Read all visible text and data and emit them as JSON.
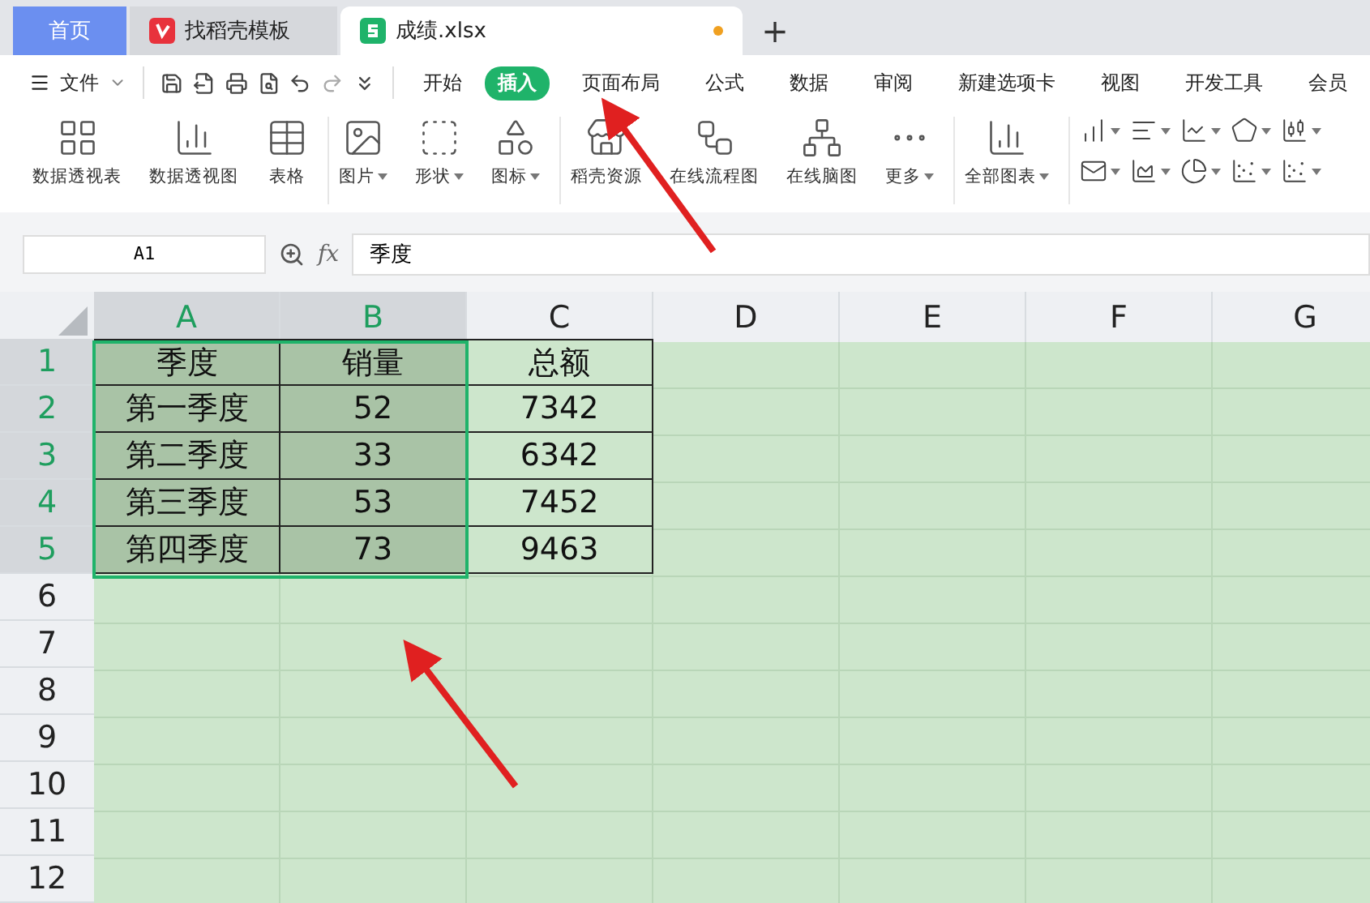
{
  "tabs": [
    {
      "kind": "home",
      "label": "首页",
      "selected": false
    },
    {
      "kind": "template",
      "label": "找稻壳模板",
      "selected": false
    },
    {
      "kind": "sheet",
      "label": "成绩.xlsx",
      "selected": true,
      "unsaved": true
    }
  ],
  "new_tab": "+",
  "menu": {
    "file": "文件",
    "items": [
      {
        "label": "开始",
        "selected": false
      },
      {
        "label": "插入",
        "selected": true
      },
      {
        "label": "页面布局",
        "selected": false
      },
      {
        "label": "公式",
        "selected": false
      },
      {
        "label": "数据",
        "selected": false
      },
      {
        "label": "审阅",
        "selected": false
      },
      {
        "label": "新建选项卡",
        "selected": false
      },
      {
        "label": "视图",
        "selected": false
      },
      {
        "label": "开发工具",
        "selected": false
      },
      {
        "label": "会员",
        "selected": false
      }
    ]
  },
  "ribbon": [
    [
      {
        "label": "数据透视表",
        "dropdown": false
      },
      {
        "label": "数据透视图",
        "dropdown": false
      },
      {
        "label": "表格",
        "dropdown": false
      }
    ],
    [
      {
        "label": "图片",
        "dropdown": true
      },
      {
        "label": "形状",
        "dropdown": true
      },
      {
        "label": "图标",
        "dropdown": true
      }
    ],
    [
      {
        "label": "稻壳资源",
        "dropdown": false
      },
      {
        "label": "在线流程图",
        "dropdown": false
      },
      {
        "label": "在线脑图",
        "dropdown": false
      },
      {
        "label": "更多",
        "dropdown": true
      }
    ],
    [
      {
        "label": "全部图表",
        "dropdown": true
      }
    ]
  ],
  "formula_bar": {
    "cell_ref": "A1",
    "fx_label": "fx",
    "value": "季度"
  },
  "sheet": {
    "columns": [
      {
        "label": "A",
        "selected": true
      },
      {
        "label": "B",
        "selected": true
      },
      {
        "label": "C",
        "selected": false
      },
      {
        "label": "D",
        "selected": false
      },
      {
        "label": "E",
        "selected": false
      },
      {
        "label": "F",
        "selected": false
      },
      {
        "label": "G",
        "selected": false
      }
    ],
    "rows": [
      {
        "label": "1",
        "selected": true,
        "cells": [
          {
            "value": "季度",
            "selected": true
          },
          {
            "value": "销量",
            "selected": true
          },
          {
            "value": "总额",
            "selected": false
          }
        ]
      },
      {
        "label": "2",
        "selected": true,
        "cells": [
          {
            "value": "第一季度",
            "selected": true
          },
          {
            "value": "52",
            "selected": true
          },
          {
            "value": "7342",
            "selected": false
          }
        ]
      },
      {
        "label": "3",
        "selected": true,
        "cells": [
          {
            "value": "第二季度",
            "selected": true
          },
          {
            "value": "33",
            "selected": true
          },
          {
            "value": "6342",
            "selected": false
          }
        ]
      },
      {
        "label": "4",
        "selected": true,
        "cells": [
          {
            "value": "第三季度",
            "selected": true
          },
          {
            "value": "53",
            "selected": true
          },
          {
            "value": "7452",
            "selected": false
          }
        ]
      },
      {
        "label": "5",
        "selected": true,
        "cells": [
          {
            "value": "第四季度",
            "selected": true
          },
          {
            "value": "73",
            "selected": true
          },
          {
            "value": "9463",
            "selected": false
          }
        ]
      },
      {
        "label": "6",
        "selected": false,
        "cells": []
      },
      {
        "label": "7",
        "selected": false,
        "cells": []
      },
      {
        "label": "8",
        "selected": false,
        "cells": []
      },
      {
        "label": "9",
        "selected": false,
        "cells": []
      },
      {
        "label": "10",
        "selected": false,
        "cells": []
      },
      {
        "label": "11",
        "selected": false,
        "cells": []
      },
      {
        "label": "12",
        "selected": false,
        "cells": []
      }
    ]
  }
}
